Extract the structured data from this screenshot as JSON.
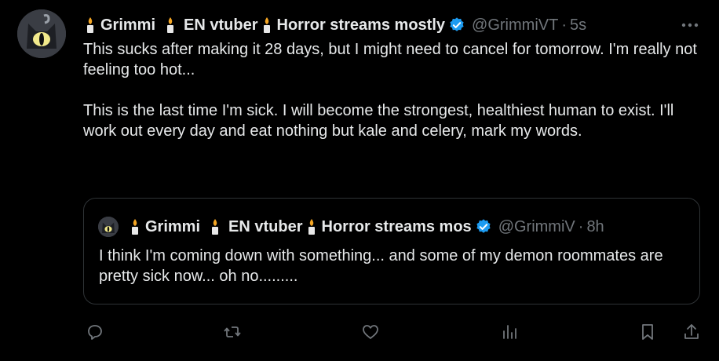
{
  "tweet": {
    "display_name_parts": [
      "Grimmi",
      "EN vtuber",
      "Horror streams mostly"
    ],
    "handle": "@GrimmiVT",
    "separator": "·",
    "time": "5s",
    "paragraphs": [
      "This sucks after making it 28 days, but I might need to cancel for tomorrow. I'm really not feeling too hot...",
      "This is the last time I'm sick. I will become the strongest, healthiest human to exist. I'll work out every day and eat nothing but kale and celery, mark my words."
    ]
  },
  "quoted_tweet": {
    "display_name_parts": [
      "Grimmi",
      "EN vtuber",
      "Horror streams mos"
    ],
    "handle": "@GrimmiV",
    "separator": "·",
    "time": "8h",
    "text": "I think I'm coming down with something... and some of my demon roommates are pretty sick now... oh no........."
  },
  "icons": {
    "more": "more-dots-icon",
    "verified": "verified-badge-icon",
    "candle": "candle-icon",
    "reply": "reply-icon",
    "retweet": "retweet-icon",
    "like": "heart-icon",
    "views": "views-chart-icon",
    "bookmark": "bookmark-icon",
    "share": "share-icon"
  },
  "colors": {
    "background": "#000000",
    "text": "#e7e9ea",
    "muted": "#71767b",
    "verified": "#1d9bf0",
    "border": "#2f3336"
  }
}
